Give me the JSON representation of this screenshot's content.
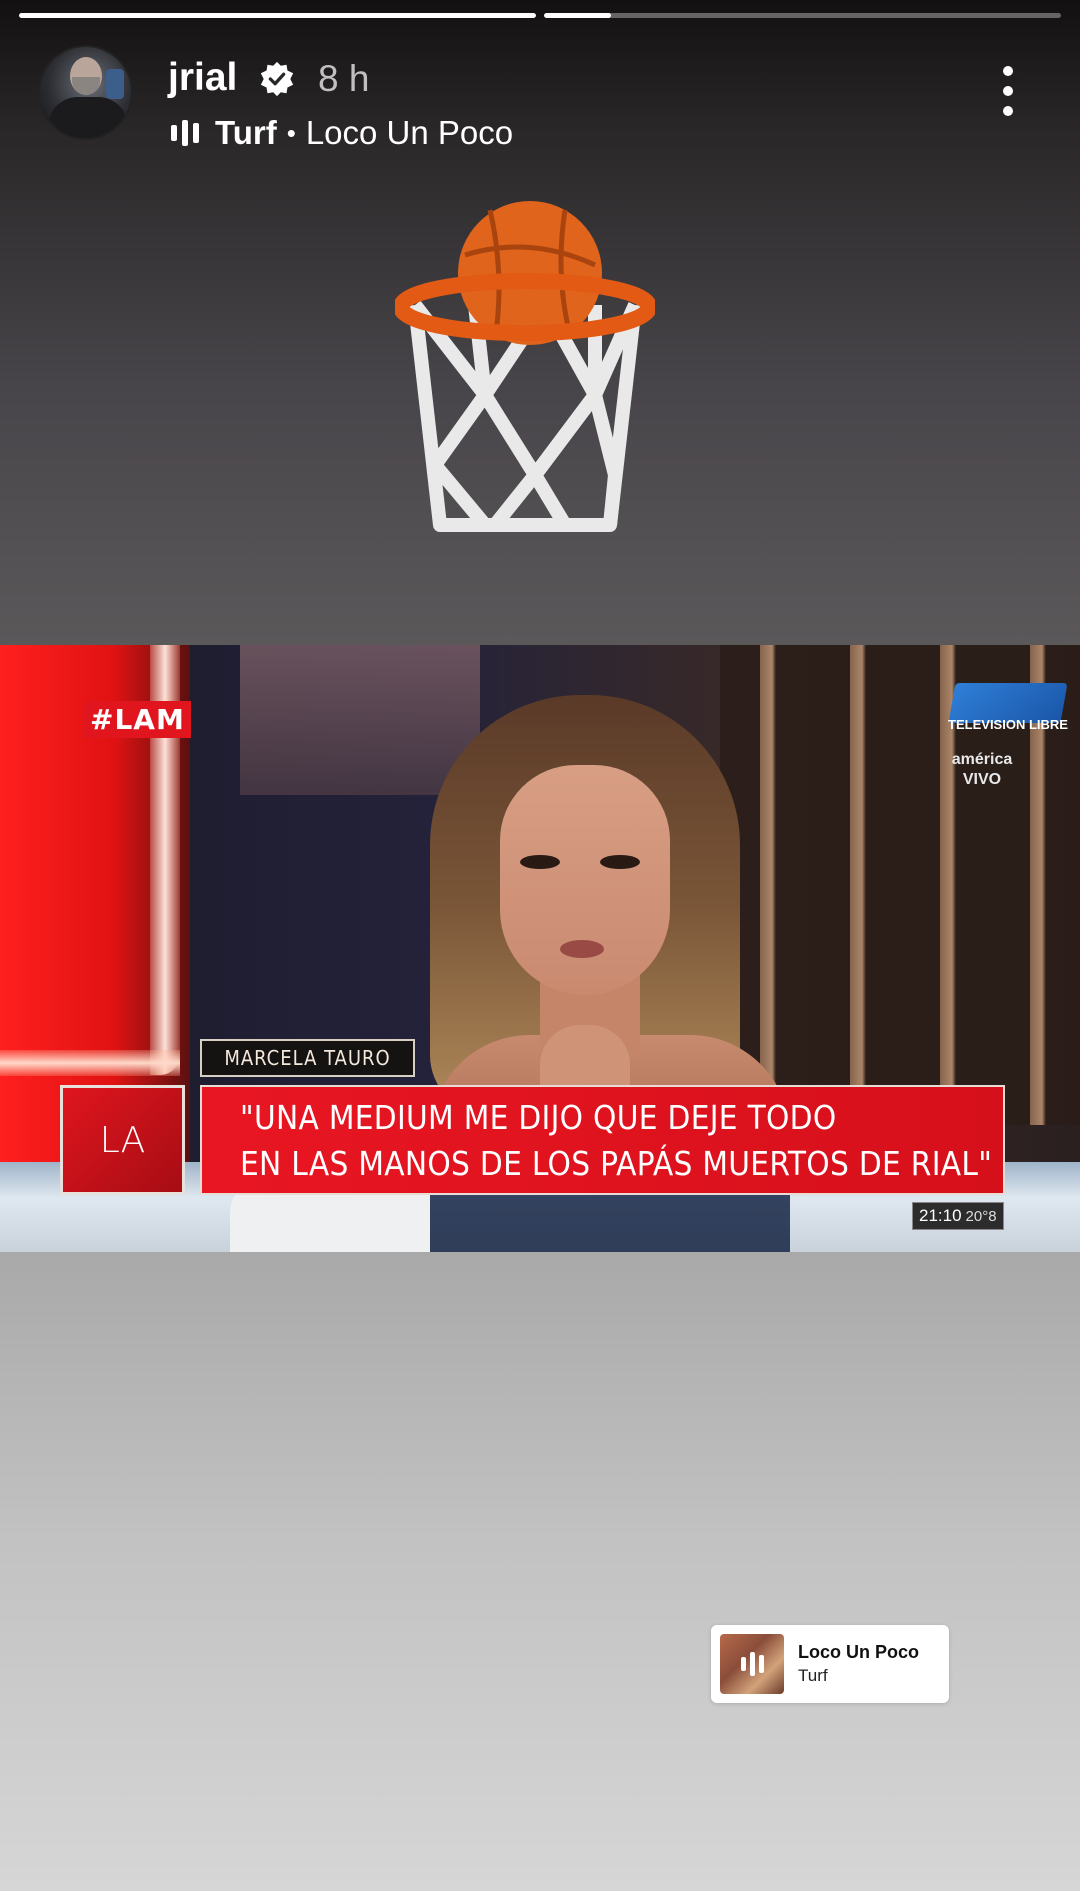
{
  "story": {
    "progress": [
      {
        "filled": 1.0
      },
      {
        "filled": 0.13
      }
    ]
  },
  "header": {
    "username": "jrial",
    "time_ago": "8 h",
    "music_artist": "Turf",
    "music_separator": "•",
    "music_title": "Loco Un Poco"
  },
  "tv_screen": {
    "hashtag": "#LAM",
    "channel_logo_text": "TELEVISION LIBRE",
    "network_line1": "américa",
    "network_line2": "VIVO",
    "name_plate": "MARCELA TAURO",
    "show_logo": "LA",
    "quote_line1": "\"UNA MEDIUM ME DIJO QUE DEJE TODO",
    "quote_line2": "EN LAS MANOS DE LOS PAPÁS MUERTOS DE RIAL\"",
    "clock_time": "21:10",
    "clock_temp": "20°8"
  },
  "music_sticker": {
    "title": "Loco Un Poco",
    "artist": "Turf"
  },
  "colors": {
    "accent_red": "#e0151e",
    "verified_badge": "#ffffff"
  }
}
